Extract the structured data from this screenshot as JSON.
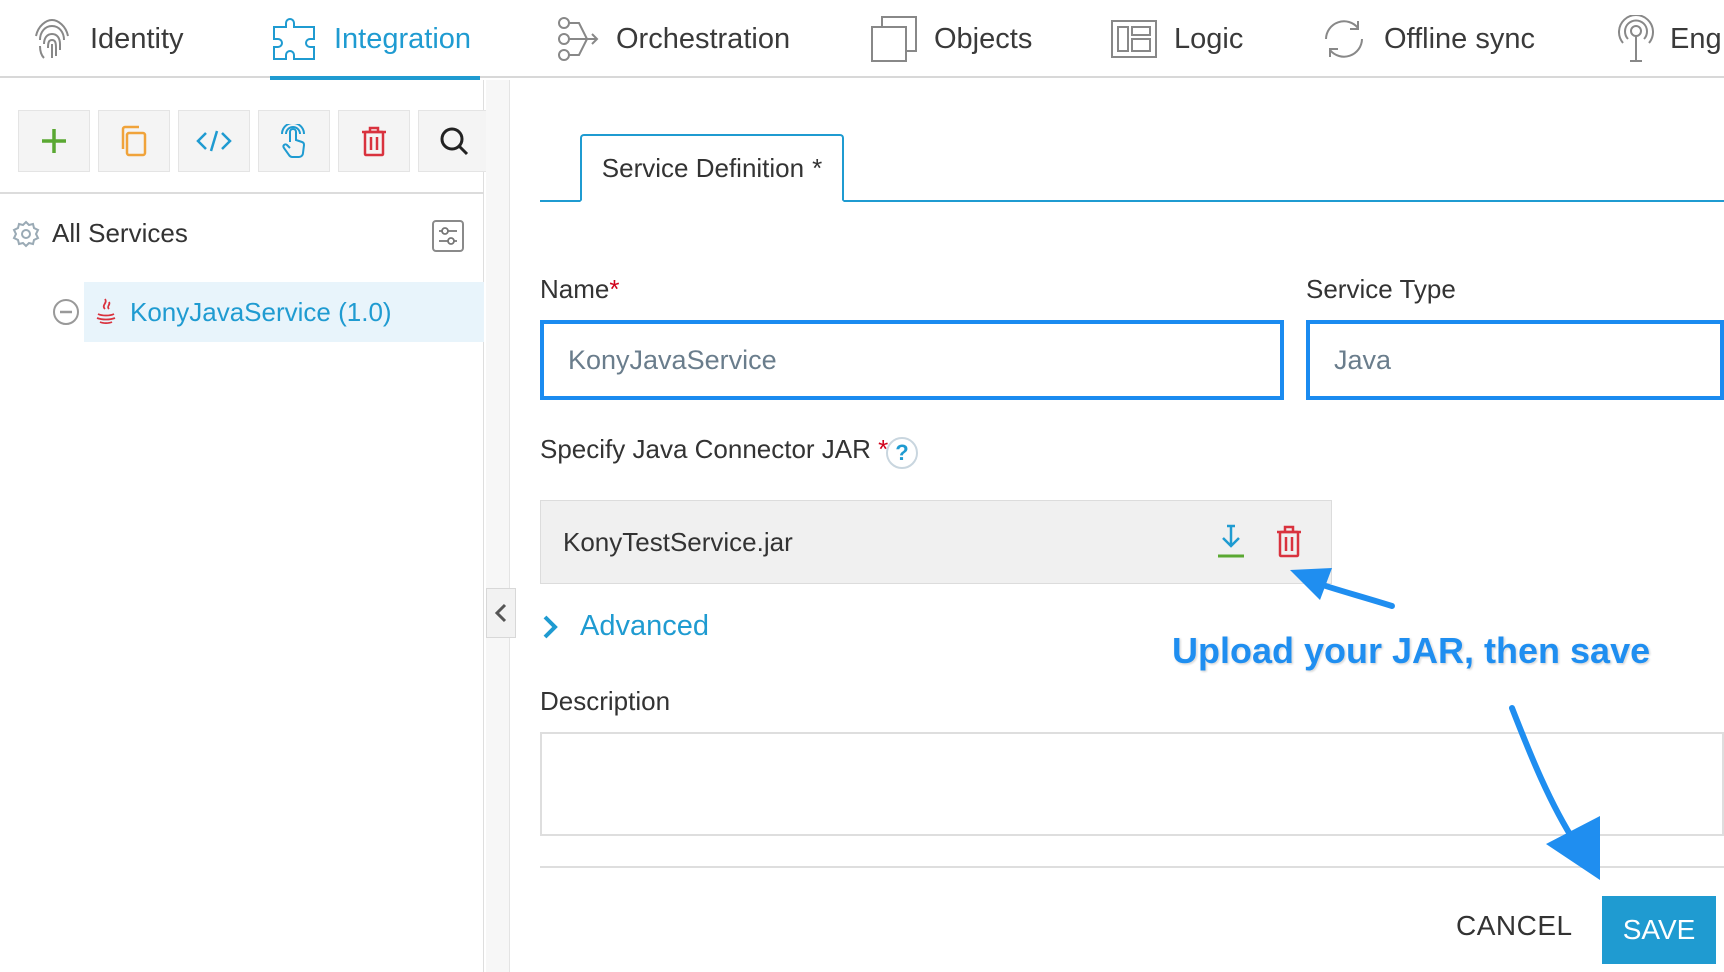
{
  "topnav": {
    "items": [
      {
        "label": "Identity",
        "icon": "fingerprint-icon"
      },
      {
        "label": "Integration",
        "icon": "puzzle-icon",
        "active": true
      },
      {
        "label": "Orchestration",
        "icon": "orchestration-icon"
      },
      {
        "label": "Objects",
        "icon": "objects-icon"
      },
      {
        "label": "Logic",
        "icon": "logic-icon"
      },
      {
        "label": "Offline sync",
        "icon": "sync-icon"
      },
      {
        "label": "Eng",
        "icon": "engagement-icon"
      }
    ]
  },
  "sidebar": {
    "toolbar": [
      "add-icon",
      "copy-icon",
      "code-icon",
      "touch-icon",
      "delete-icon",
      "search-icon"
    ],
    "root_label": "All Services",
    "service_label": "KonyJavaService (1.0)"
  },
  "main": {
    "tab_label": "Service Definition",
    "tab_marker": "*",
    "name_label": "Name",
    "required_marker": "*",
    "name_value": "KonyJavaService",
    "service_type_label": "Service Type",
    "service_type_value": "Java",
    "jar_label": "Specify Java Connector JAR",
    "help_glyph": "?",
    "jar_file": "KonyTestService.jar",
    "advanced_label": "Advanced",
    "description_label": "Description",
    "cancel_label": "CANCEL",
    "save_label": "SAVE"
  },
  "annotation": {
    "text": "Upload your JAR, then save"
  },
  "colors": {
    "accent": "#1f9bd1",
    "input_border": "#1a8bf0",
    "required": "#d0021b",
    "annotation": "#1f8ef0",
    "add_green": "#5aa832",
    "delete_red": "#d9323e"
  }
}
